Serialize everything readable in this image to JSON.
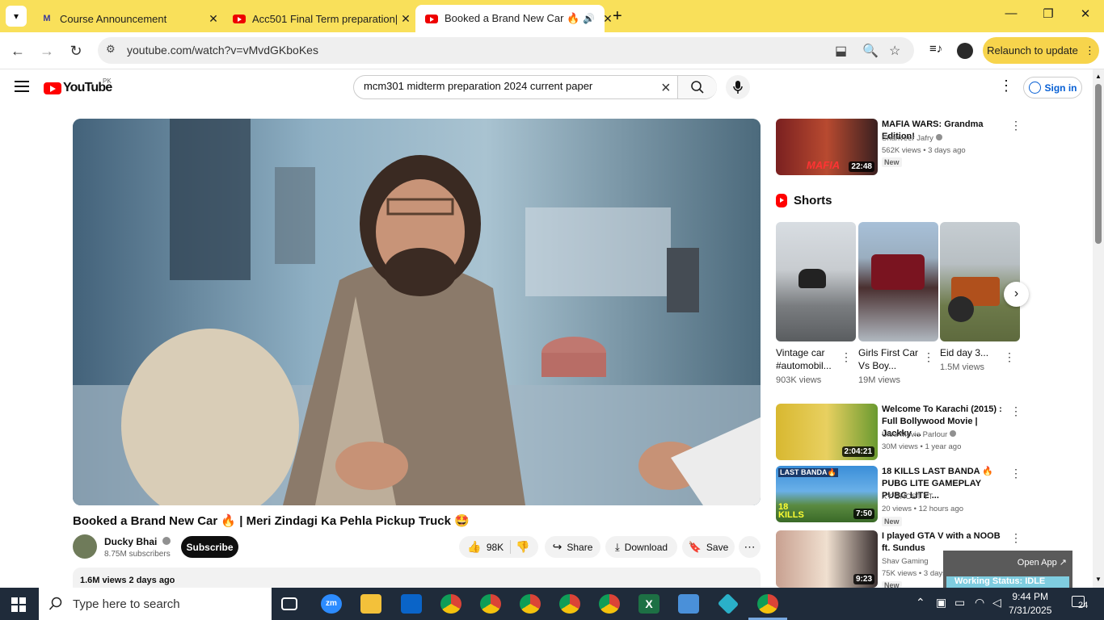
{
  "browser": {
    "tabs": [
      {
        "title": "Course Announcement",
        "active": false
      },
      {
        "title": "Acc501 Final Term preparation||",
        "active": false
      },
      {
        "title": "Booked a Brand New Car 🔥",
        "active": true
      }
    ],
    "url": "youtube.com/watch?v=vMvdGKboKes",
    "relaunch_label": "Relaunch to update"
  },
  "youtube": {
    "logo_text": "YouTube",
    "country": "PK",
    "search_value": "mcm301 midterm preparation 2024 current paper",
    "signin_label": "Sign in"
  },
  "video": {
    "title": "Booked a Brand New Car 🔥 | Meri Zindagi Ka Pehla Pickup Truck 🤩",
    "channel": "Ducky Bhai",
    "subscribers": "8.75M subscribers",
    "subscribe_label": "Subscribe",
    "likes": "98K",
    "share_label": "Share",
    "download_label": "Download",
    "save_label": "Save",
    "views_date": "1.6M views  2 days ago"
  },
  "sidebar": {
    "top": {
      "title": "MAFIA WARS: Grandma Edition!",
      "channel": "Shahveer Jafry",
      "meta": "562K views • 3 days ago",
      "badge": "New",
      "duration": "22:48",
      "thumb_text": "MAFIA"
    },
    "shorts_title": "Shorts",
    "shorts": [
      {
        "title": "Vintage car #automobil...",
        "views": "903K views"
      },
      {
        "title": "Girls First Car Vs Boy...",
        "views": "19M views"
      },
      {
        "title": "Eid day 3...",
        "views": "1.5M views"
      }
    ],
    "videos": [
      {
        "title": "Welcome To Karachi (2015) : Full Bollywood Movie | Jackky ...",
        "channel": "Ultra Movie Parlour",
        "meta": "30M views • 1 year ago",
        "duration": "2:04:21",
        "badge": ""
      },
      {
        "title": "18 KILLS LAST BANDA 🔥 PUBG LITE GAMEPLAY PUBG LITE ...",
        "channel": "XY GHOST YT",
        "meta": "20 views • 12 hours ago",
        "duration": "7:50",
        "badge": "New"
      },
      {
        "title": "I played GTA V with a NOOB ft. Sundus",
        "channel": "Shav Gaming",
        "meta": "75K views • 3 days ago",
        "duration": "9:23",
        "badge": "New"
      }
    ]
  },
  "overlay": {
    "open_app": "Open App ↗",
    "status": "Working Status: IDLE"
  },
  "taskbar": {
    "search_placeholder": "Type here to search",
    "time": "9:44 PM",
    "date": "7/31/2025",
    "notifications": "24"
  },
  "colors": {
    "tabbar": "#f9e05a",
    "youtube_red": "#ff0000",
    "link_blue": "#065fd4",
    "taskbar": "#1f2b3a"
  }
}
